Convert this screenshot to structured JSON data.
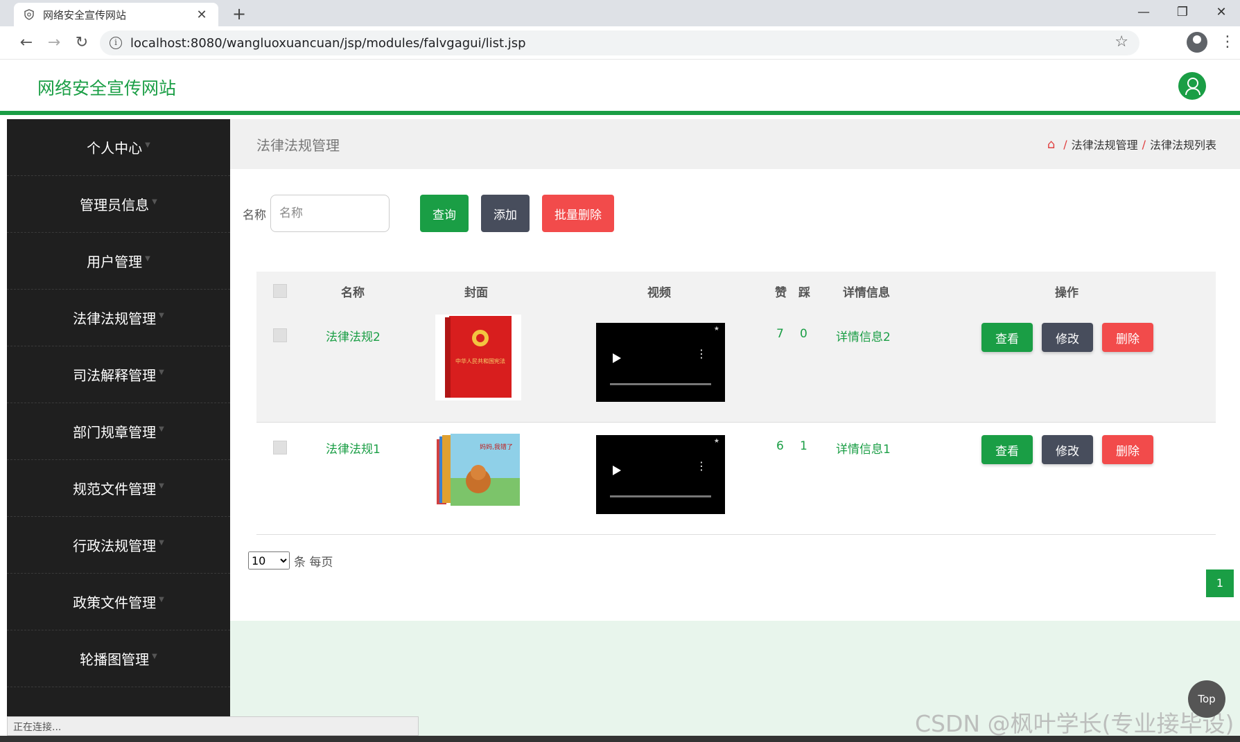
{
  "browser": {
    "tab_title": "网络安全宣传网站",
    "new_tab": "+",
    "url": "localhost:8080/wangluoxuancuan/jsp/modules/falvgagui/list.jsp",
    "win_minimize": "—",
    "win_restore": "❐",
    "win_close": "✕",
    "status_text": "正在连接..."
  },
  "header": {
    "site_title": "网络安全宣传网站"
  },
  "sidebar": {
    "items": [
      {
        "label": "个人中心"
      },
      {
        "label": "管理员信息"
      },
      {
        "label": "用户管理"
      },
      {
        "label": "法律法规管理"
      },
      {
        "label": "司法解释管理"
      },
      {
        "label": "部门规章管理"
      },
      {
        "label": "规范文件管理"
      },
      {
        "label": "行政法规管理"
      },
      {
        "label": "政策文件管理"
      },
      {
        "label": "轮播图管理"
      }
    ]
  },
  "page": {
    "title": "法律法规管理",
    "breadcrumb": [
      "法律法规管理",
      "法律法规列表"
    ]
  },
  "search": {
    "label": "名称",
    "placeholder": "名称",
    "query_button": "查询",
    "add_button": "添加",
    "batch_delete_button": "批量删除"
  },
  "table": {
    "headers": {
      "name": "名称",
      "cover": "封面",
      "video": "视频",
      "likes": "赞",
      "dislikes": "踩",
      "detail": "详情信息",
      "actions": "操作"
    },
    "rows": [
      {
        "name": "法律法规2",
        "likes": "7",
        "dislikes": "0",
        "detail": "详情信息2",
        "cover_text": "中华人民共和国宪法"
      },
      {
        "name": "法律法规1",
        "likes": "6",
        "dislikes": "1",
        "detail": "详情信息1",
        "cover_text": "妈妈,我错了"
      }
    ],
    "view_button": "查看",
    "edit_button": "修改",
    "delete_button": "删除"
  },
  "pagination": {
    "page_size": "10",
    "page_size_options": [
      "10"
    ],
    "per_page_label": "条 每页",
    "current_page": "1"
  },
  "top_button": "Top",
  "watermark": "CSDN @枫叶学长(专业接毕设)",
  "colors": {
    "brand_green": "#1a9e45",
    "sidebar_bg": "#1f1f1f",
    "danger_red": "#f24b4b",
    "dark_slate": "#474d5c"
  }
}
